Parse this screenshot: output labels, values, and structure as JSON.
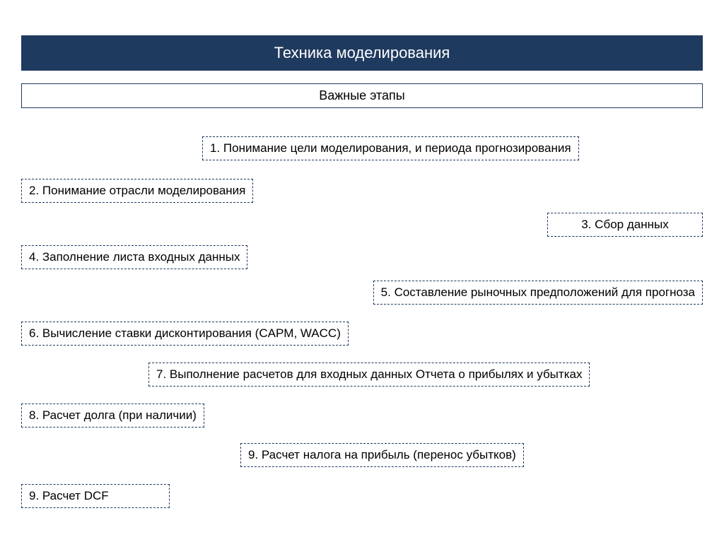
{
  "title": "Техника моделирования",
  "subtitle": "Важные этапы",
  "steps": {
    "s1": "1. Понимание цели моделирования, и периода прогнозирования",
    "s2": "2. Понимание отрасли моделирования",
    "s3": "3. Сбор данных",
    "s4": "4. Заполнение листа входных данных",
    "s5": "5. Составление рыночных предположений для прогноза",
    "s6": "6. Вычисление ставки дисконтирования (CAPM, WACC)",
    "s7": "7. Выполнение расчетов для входных данных Отчета о прибылях и убытках",
    "s8": "8. Расчет долга (при наличии)",
    "s9": "9. Расчет налога на прибыль (перенос убытков)",
    "s10": "9. Расчет DCF"
  }
}
